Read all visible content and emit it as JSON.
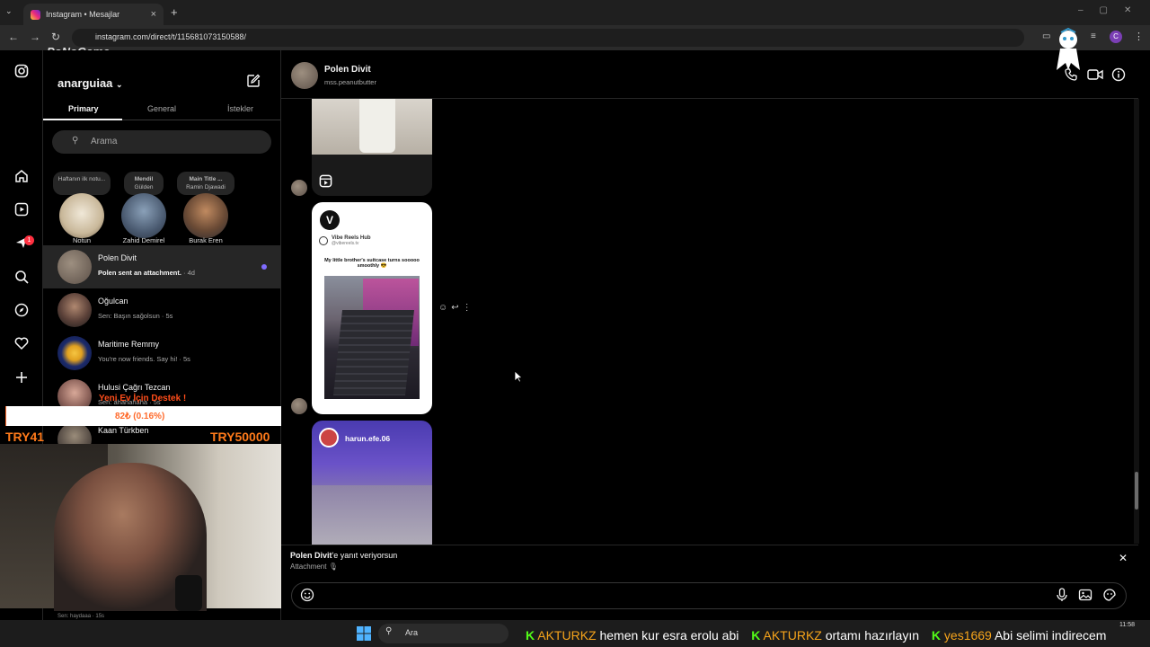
{
  "browser": {
    "tab_title": "Instagram • Mesajlar",
    "url": "instagram.com/direct/t/115681073150588/",
    "profile_initial": "C",
    "close_tab": "×",
    "new_tab": "+"
  },
  "brand_overlay": "PoNoGame",
  "inbox": {
    "username": "anarguiaa",
    "tabs": [
      "Primary",
      "General",
      "İstekler"
    ],
    "search_placeholder": "Arama",
    "notes": [
      {
        "note": "Haftanın ilk notu...",
        "name": "Notun",
        "sub": ""
      },
      {
        "note": "Mendil",
        "name": "Zahid Demirel",
        "sub": "Gülden"
      },
      {
        "note": "Main Title ...",
        "name": "Burak Eren",
        "sub": "Ramin Djawadi"
      }
    ],
    "conversations": [
      {
        "name": "Polen Divit",
        "preview": "Polen sent an attachment.",
        "time": "· 4d"
      },
      {
        "name": "Oğulcan",
        "preview": "Sen: Başın sağolsun",
        "time": "· 5s"
      },
      {
        "name": "Maritime Remmy",
        "preview": "You're now friends. Say hi!",
        "time": "· 5s"
      },
      {
        "name": "Hulusi Çağrı Tezcan",
        "preview": "Sen: ahahahaha",
        "time": "· 5s"
      },
      {
        "name": "Kaan Türkben",
        "preview": "",
        "time": ""
      }
    ],
    "last_preview": "Sen: haydaaa · 15s"
  },
  "rail": {
    "notification_count": "1"
  },
  "donation": {
    "title": "Yeni Ev İçin Destek !",
    "progress": "82₺ (0.16%)",
    "progress_fraction": 0.0016,
    "current": "TRY41",
    "goal": "TRY50000"
  },
  "chat": {
    "name": "Polen Divit",
    "handle": "mss.peanutbutter",
    "vibe_account": "Vibe Reels Hub",
    "vibe_handle": "@vibereels.tv",
    "vibe_caption": "My little brother's suitcase turns sooooo smoothly 😎",
    "reel_author": "harun.efe.06",
    "reply_to_name": "Polen Divit",
    "reply_to_suffix": "'e yanıt veriyorsun",
    "reply_sub": "Attachment"
  },
  "taskbar": {
    "search": "Ara",
    "time": "11:58"
  },
  "ticker": [
    {
      "user": "AKTURKZ",
      "msg": "hemen kur esra erolu abi"
    },
    {
      "user": "AKTURKZ",
      "msg": "ortamı hazırlayın"
    },
    {
      "user": "yes1669",
      "msg": "Abi selimi indirecem"
    }
  ],
  "colors": {
    "unread_dot": "#7f6bff",
    "badge_red": "#ff3040",
    "donation_orange": "#ff6a2b",
    "kick_green": "#53fc18"
  }
}
